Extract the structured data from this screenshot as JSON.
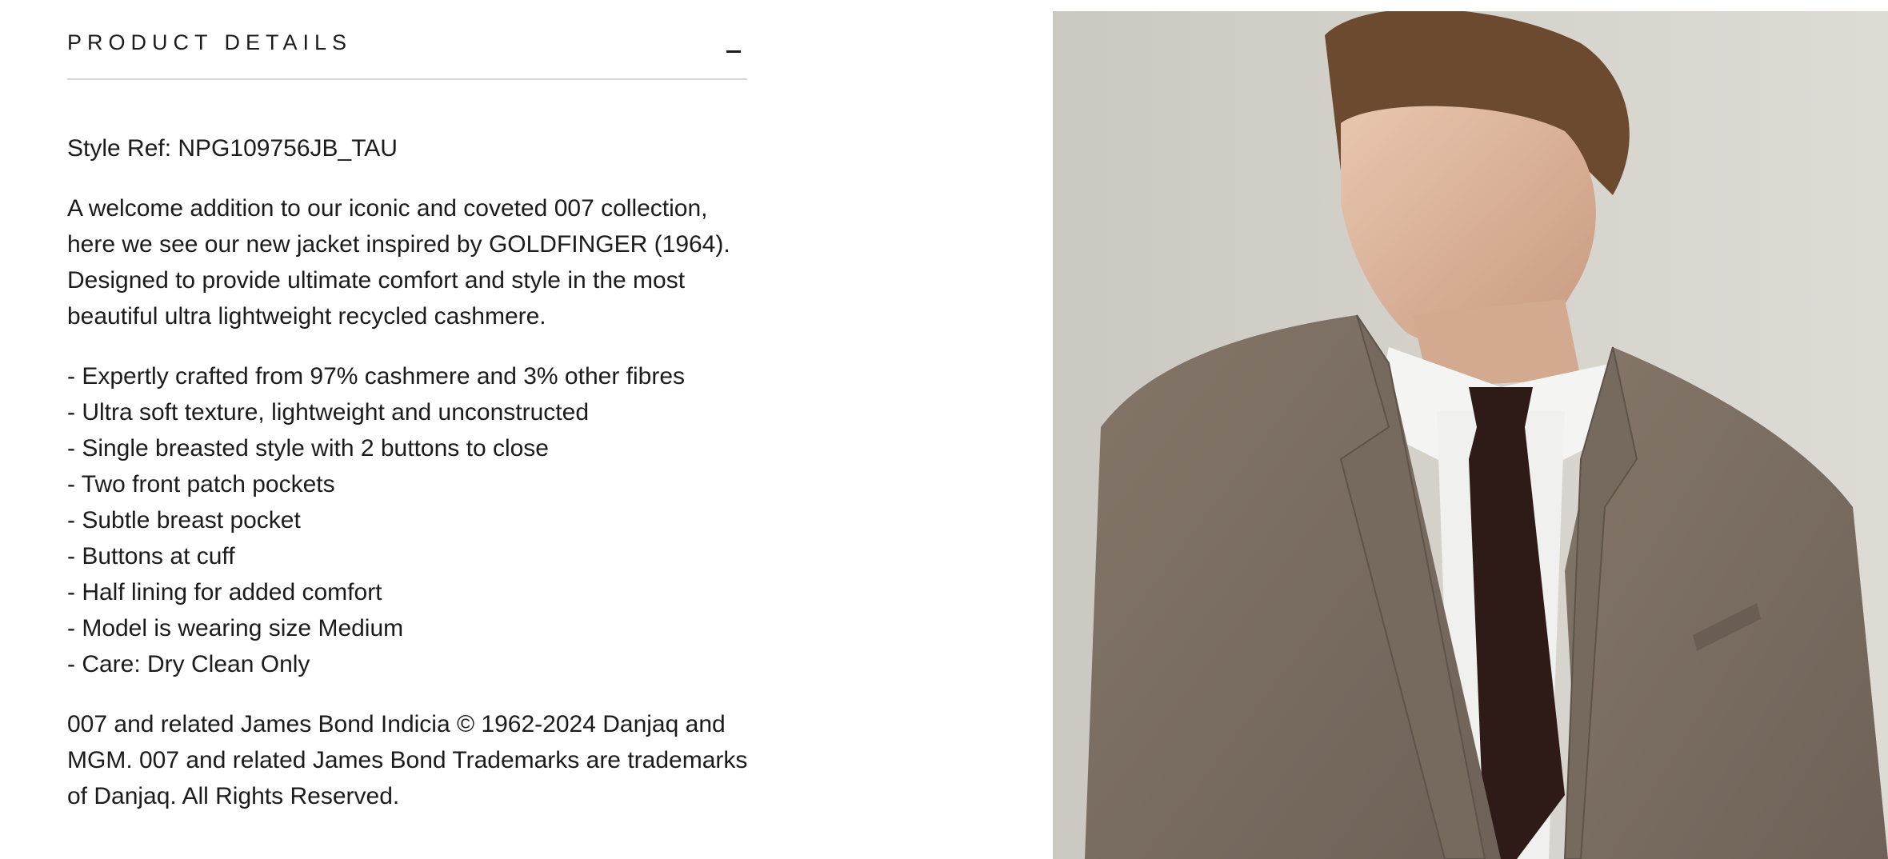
{
  "accordion": {
    "title": "PRODUCT DETAILS",
    "toggle_icon": "minus-icon",
    "expanded": true
  },
  "style_ref": "Style Ref: NPG109756JB_TAU",
  "description": "A welcome addition to our iconic and coveted 007 collection, here we see our new jacket inspired by GOLDFINGER (1964). Designed to provide ultimate comfort and style in the most beautiful ultra lightweight recycled cashmere.",
  "features": [
    "- Expertly crafted from 97% cashmere and 3% other fibres",
    "- Ultra soft texture, lightweight and unconstructed",
    "- Single breasted style with 2 buttons to close",
    "- Two front patch pockets",
    "- Subtle breast pocket",
    "- Buttons at cuff",
    "- Half lining for added comfort",
    "- Model is wearing size Medium",
    "- Care: Dry Clean Only"
  ],
  "legal": "007 and related James Bond Indicia © 1962-2024 Danjaq and MGM. 007 and related James Bond Trademarks are trademarks of Danjaq. All Rights Reserved.",
  "colors": {
    "text": "#1b1b1b",
    "divider": "#d6d6d6",
    "background": "#ffffff",
    "jacket": "#7a6d62",
    "tie": "#2e1a17",
    "shirt": "#f4f4f2",
    "backdrop": "#c9c6bf"
  }
}
